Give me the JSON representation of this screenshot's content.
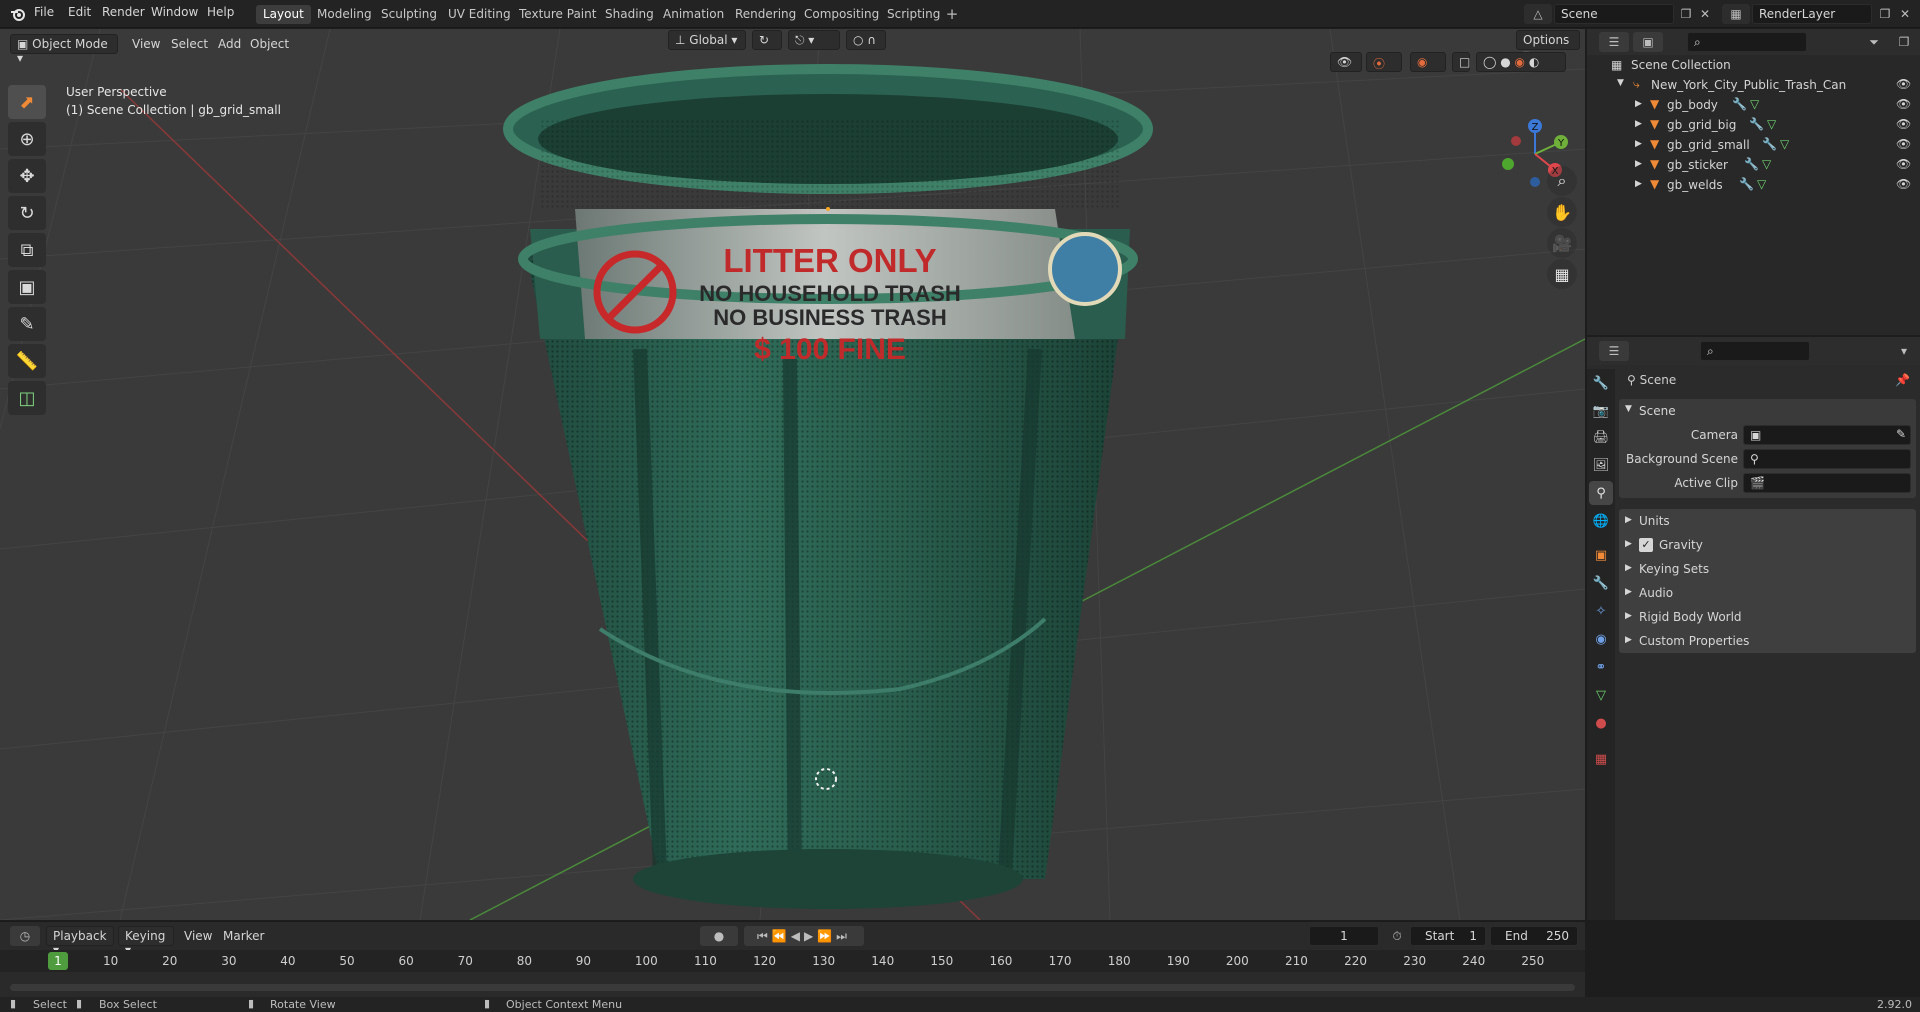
{
  "app": {
    "version": "2.92.0"
  },
  "menus": [
    "File",
    "Edit",
    "Render",
    "Window",
    "Help"
  ],
  "workspaces": [
    "Layout",
    "Modeling",
    "Sculpting",
    "UV Editing",
    "Texture Paint",
    "Shading",
    "Animation",
    "Rendering",
    "Compositing",
    "Scripting"
  ],
  "active_workspace": "Layout",
  "topright": {
    "scene": "Scene",
    "view_layer": "RenderLayer"
  },
  "viewport": {
    "mode": "Object Mode",
    "menus": [
      "View",
      "Select",
      "Add",
      "Object"
    ],
    "transform_orientation": "Global",
    "options_label": "Options",
    "overlay_title": "User Perspective",
    "overlay_subtitle": "(1) Scene Collection | gb_grid_small",
    "sign": {
      "line1": "LITTER ONLY",
      "line2": "NO HOUSEHOLD TRASH",
      "line3": "NO BUSINESS TRASH",
      "line4": "$ 100  FINE"
    },
    "gizmo_axes": [
      "X",
      "Y",
      "Z"
    ]
  },
  "outliner": {
    "root": "Scene Collection",
    "collection": "New_York_City_Public_Trash_Can",
    "objects": [
      "gb_body",
      "gb_grid_big",
      "gb_grid_small",
      "gb_sticker",
      "gb_welds"
    ]
  },
  "properties": {
    "context_label": "Scene",
    "panel_title": "Scene",
    "fields": [
      {
        "label": "Camera",
        "value": ""
      },
      {
        "label": "Background Scene",
        "value": ""
      },
      {
        "label": "Active Clip",
        "value": ""
      }
    ],
    "subpanels": [
      "Units",
      "Gravity",
      "Keying Sets",
      "Audio",
      "Rigid Body World",
      "Custom Properties"
    ],
    "gravity_checked": true
  },
  "timeline": {
    "menus": [
      "Playback",
      "Keying",
      "View",
      "Marker"
    ],
    "current_frame": "1",
    "start_label": "Start",
    "start": "1",
    "end_label": "End",
    "end": "250",
    "ticks": [
      "10",
      "20",
      "30",
      "40",
      "50",
      "60",
      "70",
      "80",
      "90",
      "100",
      "110",
      "120",
      "130",
      "140",
      "150",
      "160",
      "170",
      "180",
      "190",
      "200",
      "210",
      "220",
      "230",
      "240",
      "250"
    ],
    "playhead_label": "1"
  },
  "statusbar": {
    "select": "Select",
    "box_select": "Box Select",
    "rotate_view": "Rotate View",
    "context_menu": "Object Context Menu"
  }
}
